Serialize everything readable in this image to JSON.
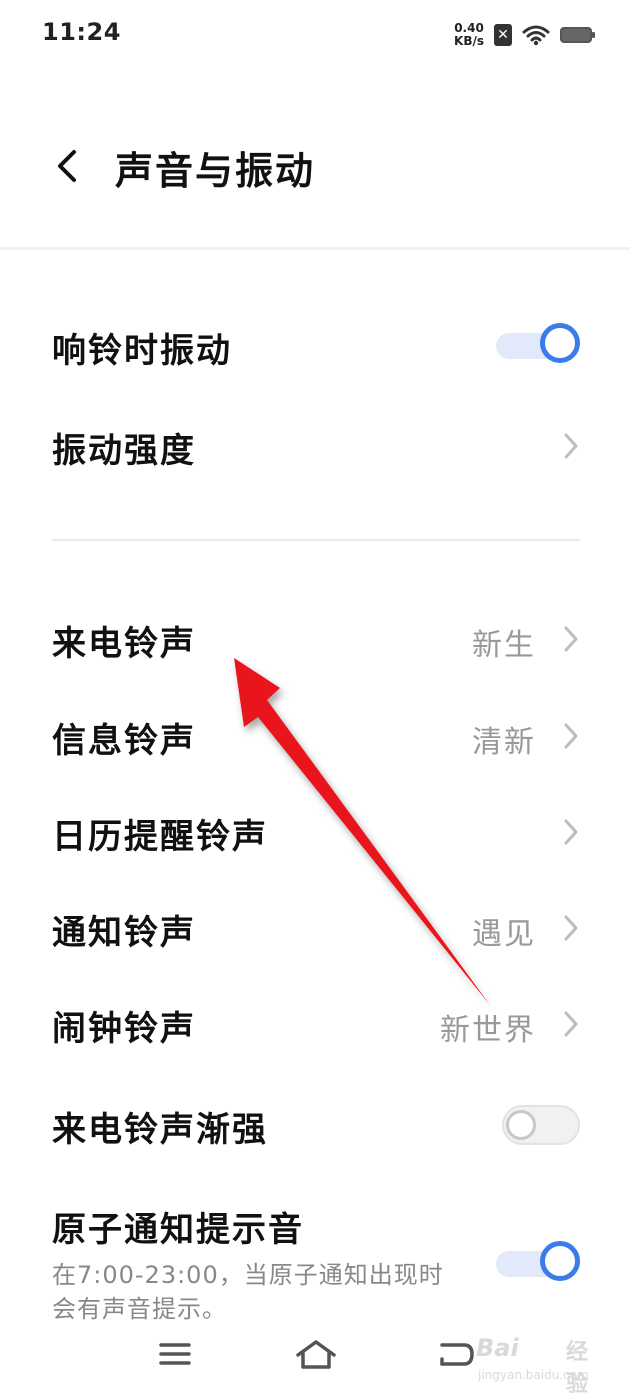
{
  "status_bar": {
    "time": "11:24",
    "net_speed_value": "0.40",
    "net_speed_unit": "KB/s",
    "icons": [
      "sim-x-icon",
      "wifi-icon",
      "battery-icon"
    ]
  },
  "header": {
    "title": "声音与振动",
    "back_icon": "chevron-left-icon"
  },
  "settings": {
    "vibrate_on_ring": {
      "label": "响铃时振动",
      "enabled": true
    },
    "vibration_strength": {
      "label": "振动强度"
    },
    "ringtone": {
      "label": "来电铃声",
      "value": "新生"
    },
    "message_tone": {
      "label": "信息铃声",
      "value": "清新"
    },
    "calendar_tone": {
      "label": "日历提醒铃声"
    },
    "notification_tone": {
      "label": "通知铃声",
      "value": "遇见"
    },
    "alarm_tone": {
      "label": "闹钟铃声",
      "value": "新世界"
    },
    "ringtone_crescendo": {
      "label": "来电铃声渐强",
      "enabled": false
    },
    "atomic_notification": {
      "label": "原子通知提示音",
      "description": "在7:00-23:00，当原子通知出现时会有声音提示。",
      "enabled": true
    }
  },
  "nav_bar": {
    "icons": [
      "menu-icon",
      "home-icon",
      "back-icon"
    ]
  },
  "watermark": {
    "logo": "Bai",
    "label": "经验",
    "url": "jingyan.baidu.com"
  },
  "colors": {
    "accent": "#3b7bea",
    "toggle_on_track": "#e1e9fb",
    "secondary_text": "#999999",
    "annotation_arrow": "#e8141b"
  }
}
